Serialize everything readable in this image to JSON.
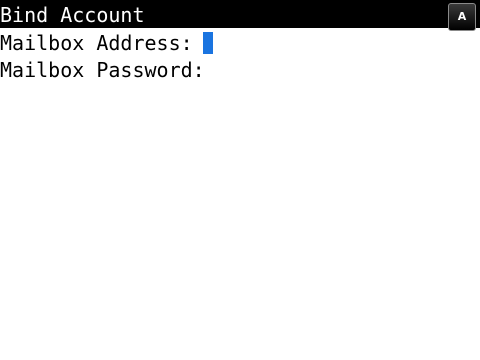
{
  "header": {
    "title": "Bind Account",
    "input_mode": "A"
  },
  "form": {
    "mailbox_address": {
      "label": "Mailbox Address:",
      "value": ""
    },
    "mailbox_password": {
      "label": "Mailbox Password:",
      "value": ""
    }
  },
  "colors": {
    "title_background": "#000000",
    "caret": "#1a74e0"
  }
}
